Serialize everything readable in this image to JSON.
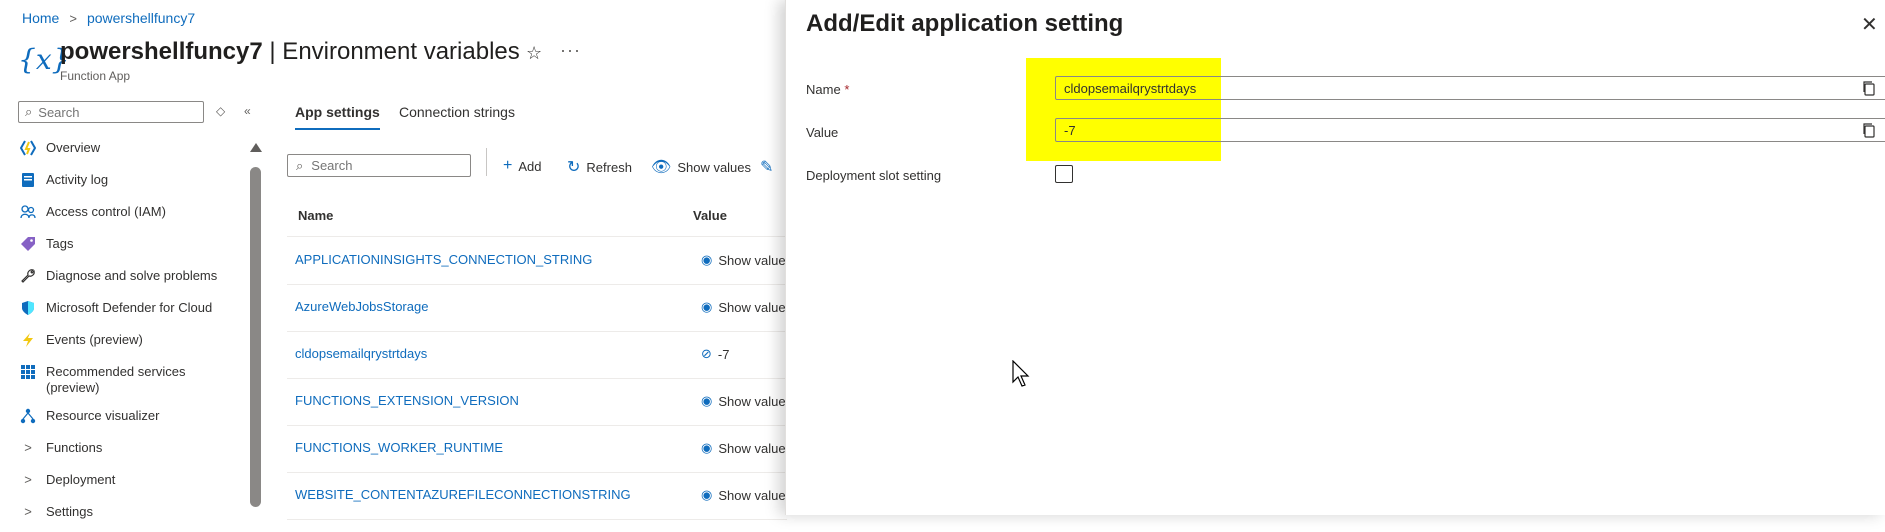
{
  "breadcrumb": {
    "home": "Home",
    "resource": "powershellfuncy7"
  },
  "header": {
    "title_resource": "powershellfuncy7",
    "title_page": "| Environment variables",
    "subtitle": "Function App"
  },
  "sidebar": {
    "search_placeholder": "Search",
    "items": [
      {
        "label": "Overview",
        "icon": "function-app-icon"
      },
      {
        "label": "Activity log",
        "icon": "activity-log-icon"
      },
      {
        "label": "Access control (IAM)",
        "icon": "people-icon"
      },
      {
        "label": "Tags",
        "icon": "tag-icon"
      },
      {
        "label": "Diagnose and solve problems",
        "icon": "wrench-icon"
      },
      {
        "label": "Microsoft Defender for Cloud",
        "icon": "shield-icon"
      },
      {
        "label": "Events (preview)",
        "icon": "lightning-icon"
      },
      {
        "label": "Recommended services (preview)",
        "icon": "grid-icon"
      },
      {
        "label": "Resource visualizer",
        "icon": "hierarchy-icon"
      },
      {
        "label": "Functions",
        "icon": "chevron-right-icon"
      },
      {
        "label": "Deployment",
        "icon": "chevron-right-icon"
      },
      {
        "label": "Settings",
        "icon": "chevron-right-icon"
      }
    ]
  },
  "tabs": [
    {
      "label": "App settings",
      "active": true
    },
    {
      "label": "Connection strings",
      "active": false
    }
  ],
  "toolbar": {
    "search_placeholder": "Search",
    "add": "Add",
    "refresh": "Refresh",
    "show_values": "Show values"
  },
  "table": {
    "columns": [
      "Name",
      "Value"
    ],
    "rows": [
      {
        "name": "APPLICATIONINSIGHTS_CONNECTION_STRING",
        "value": "Show value"
      },
      {
        "name": "AzureWebJobsStorage",
        "value": "Show value"
      },
      {
        "name": "cldopsemailqrystrtdays",
        "value": "-7"
      },
      {
        "name": "FUNCTIONS_EXTENSION_VERSION",
        "value": "Show value"
      },
      {
        "name": "FUNCTIONS_WORKER_RUNTIME",
        "value": "Show value"
      },
      {
        "name": "WEBSITE_CONTENTAZUREFILECONNECTIONSTRING",
        "value": "Show value"
      }
    ]
  },
  "panel": {
    "title": "Add/Edit application setting",
    "name_label": "Name",
    "required_marker": "*",
    "name_value": "cldopsemailqrystrtdays",
    "value_label": "Value",
    "value_value": "-7",
    "slot_label": "Deployment slot setting",
    "slot_checked": false,
    "highlight_color": "#ffff00"
  },
  "colors": {
    "link": "#0f6cbd",
    "text": "#323130"
  }
}
